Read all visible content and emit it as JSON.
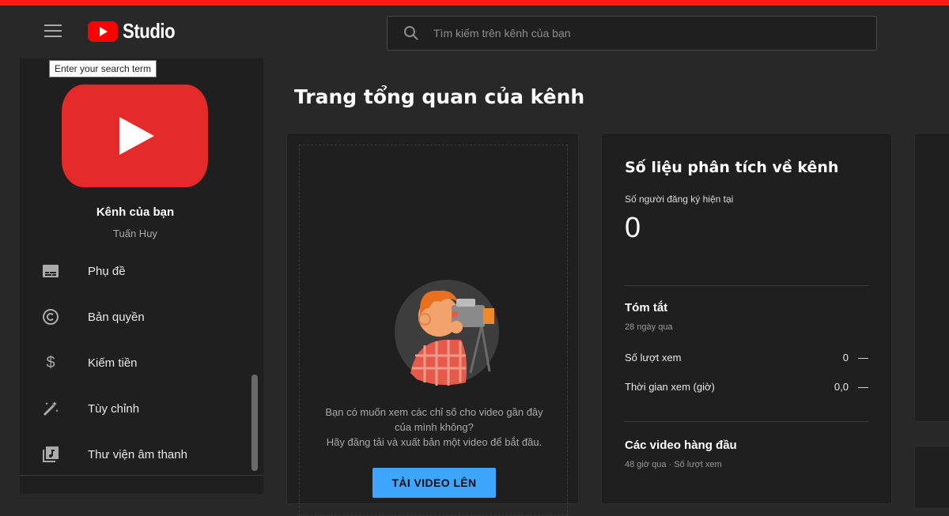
{
  "app": {
    "brand": "Studio",
    "brand_color": "#ff0000",
    "accent_color": "#3ea6ff",
    "top_stripe_color": "#ff1a1a"
  },
  "search": {
    "placeholder": "Tìm kiếm trên kênh của bạn",
    "tooltip": "Enter your search term"
  },
  "channel": {
    "name": "Kênh của bạn",
    "owner": "Tuấn Huy"
  },
  "sidebar": {
    "items": [
      {
        "label": "Phụ đề",
        "icon": "subtitles-icon"
      },
      {
        "label": "Bản quyền",
        "icon": "copyright-icon"
      },
      {
        "label": "Kiếm tiền",
        "icon": "dollar-icon"
      },
      {
        "label": "Tùy chỉnh",
        "icon": "magic-wand-icon"
      },
      {
        "label": "Thư viện âm thanh",
        "icon": "audio-library-icon"
      }
    ]
  },
  "main": {
    "title": "Trang tổng quan của kênh",
    "upload_card": {
      "line1": "Bạn có muốn xem các chỉ số cho video gần đây",
      "line2": "của mình không?",
      "line3": "Hãy đăng tải và xuất bản một video để bắt đầu.",
      "button": "TẢI VIDEO LÊN"
    },
    "analytics": {
      "title": "Số liệu phân tích về kênh",
      "subscribers_label": "Số người đăng ký hiện tại",
      "subscribers_value": "0",
      "summary_title": "Tóm tắt",
      "summary_period": "28 ngày qua",
      "rows": [
        {
          "label": "Số lượt xem",
          "value": "0",
          "trend": "—"
        },
        {
          "label": "Thời gian xem (giờ)",
          "value": "0,0",
          "trend": "—"
        }
      ],
      "top_videos_title": "Các video hàng đầu",
      "top_videos_sub": "48 giờ qua · Số lượt xem"
    }
  }
}
